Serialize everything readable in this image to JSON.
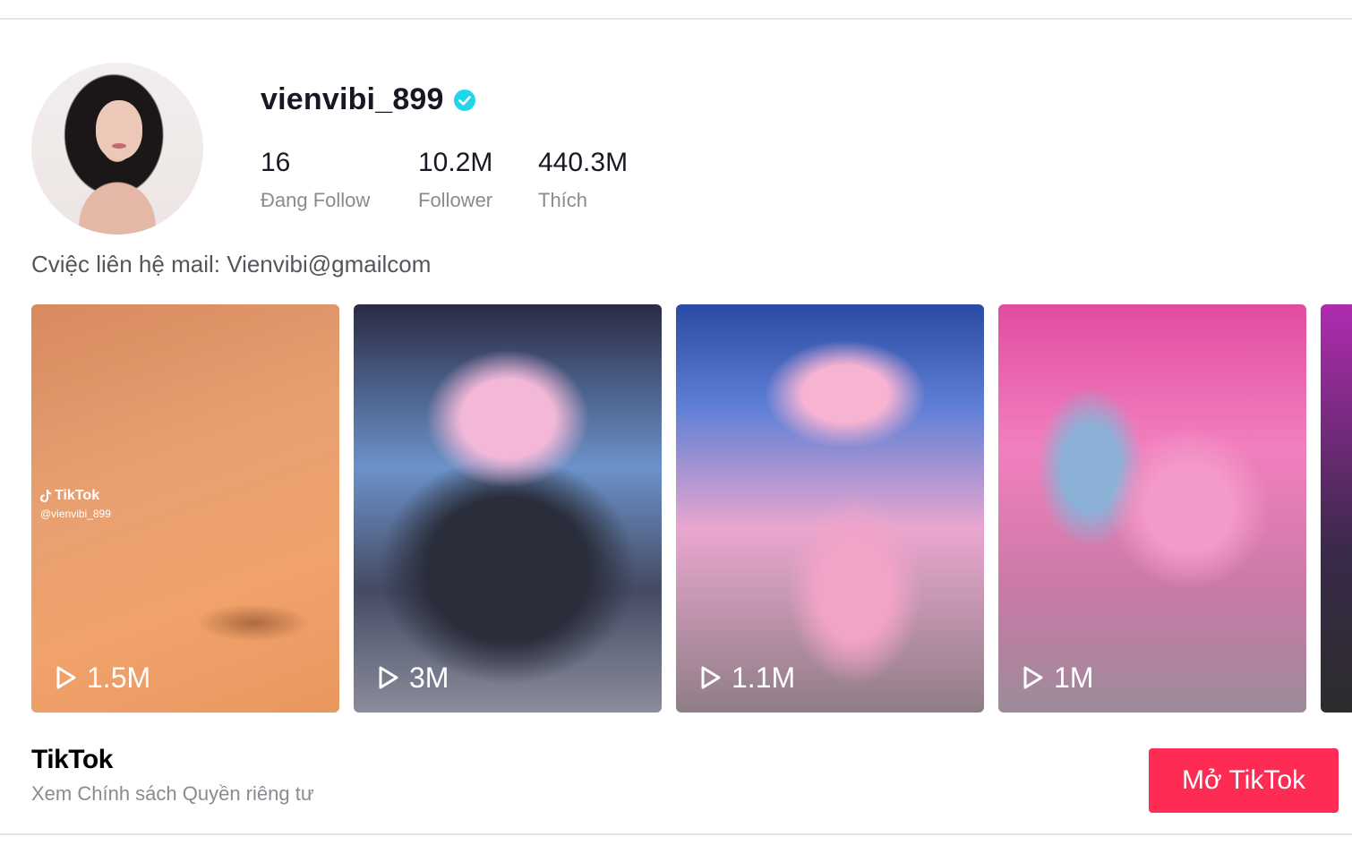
{
  "profile": {
    "username": "vienvibi_899",
    "verified": true,
    "bio": "Cviệc liên hệ mail: Vienvibi@gmailcom",
    "stats": [
      {
        "value": "16",
        "label": "Đang Follow"
      },
      {
        "value": "10.2M",
        "label": "Follower"
      },
      {
        "value": "440.3M",
        "label": "Thích"
      }
    ]
  },
  "videos": [
    {
      "views": "1.5M",
      "watermark_brand": "TikTok",
      "watermark_user": "@vienvibi_899"
    },
    {
      "views": "3M"
    },
    {
      "views": "1.1M"
    },
    {
      "views": "1M"
    }
  ],
  "footer": {
    "logo": "TikTok",
    "privacy_link": "Xem Chính sách Quyền riêng tư",
    "open_button": "Mở TikTok"
  },
  "colors": {
    "accent": "#fe2c55",
    "verified_badge": "#20d5ec",
    "muted_text": "#8a8b91"
  },
  "icons": {
    "verified": "verified-check-icon",
    "play": "play-icon"
  }
}
